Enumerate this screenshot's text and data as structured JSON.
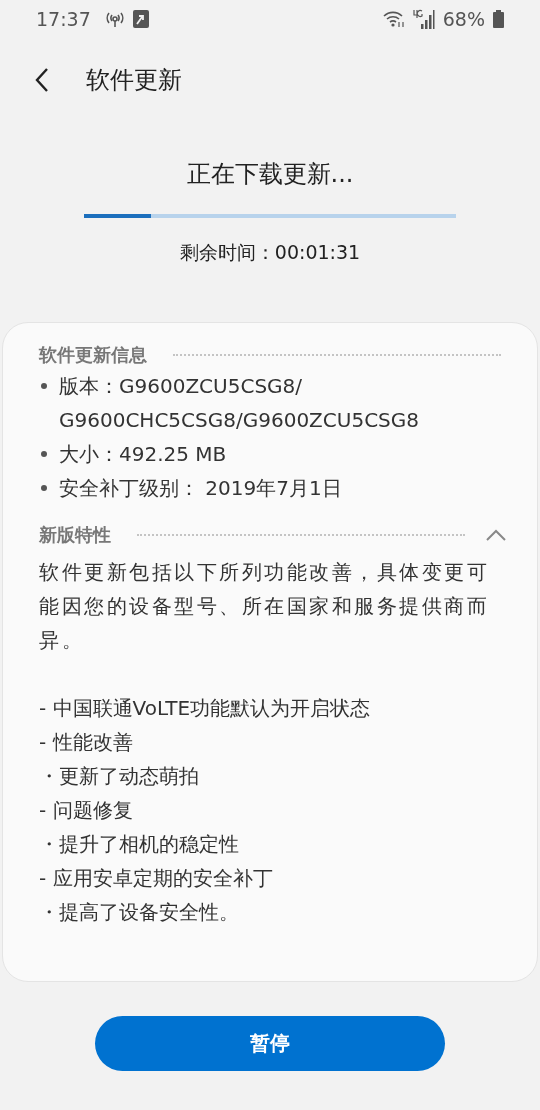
{
  "status_bar": {
    "time": "17:37",
    "battery": "68%"
  },
  "header": {
    "title": "软件更新"
  },
  "download": {
    "title": "正在下载更新...",
    "level": 0.18,
    "remaining": "剩余时间：00:01:31"
  },
  "info": {
    "heading": "软件更新信息",
    "items": [
      {
        "lines": [
          "版本：G9600ZCU5CSG8/",
          "G9600CHC5CSG8/G9600ZCU5CSG8"
        ]
      },
      {
        "lines": [
          "大小：492.25 MB"
        ]
      },
      {
        "lines": [
          "安全补丁级别： 2019年7月1日"
        ]
      }
    ]
  },
  "features": {
    "heading": "新版特性",
    "expanded": true,
    "intro": "软件更新包括以下所列功能改善，具体变更可能因您的设备型号、所在国家和服务提供商而异。",
    "lines": [
      "- 中国联通VoLTE功能默认为开启状态",
      "- 性能改善",
      "・更新了动态萌拍",
      "- 问题修复",
      "・提升了相机的稳定性",
      "- 应用安卓定期的安全补丁",
      "・提高了设备安全性。"
    ]
  },
  "button": {
    "label": "暂停"
  }
}
